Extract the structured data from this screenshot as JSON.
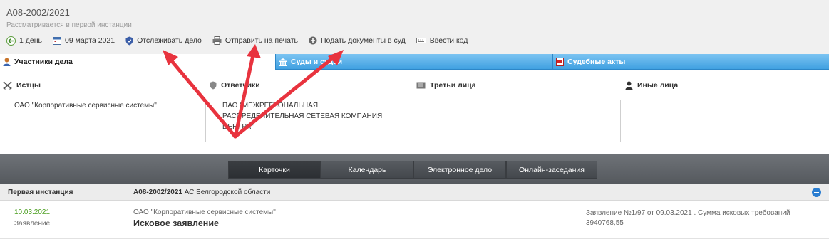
{
  "case": {
    "number": "А08-2002/2021",
    "status": "Рассматривается в первой инстанции"
  },
  "toolbar": {
    "days": "1 день",
    "date": "09 марта 2021",
    "track": "Отслеживать дело",
    "print": "Отправить на печать",
    "submit": "Подать документы в суд",
    "code": "Ввести код"
  },
  "tabs": {
    "participants": "Участники дела",
    "courts": "Суды и судьи",
    "acts": "Судебные акты"
  },
  "parties": {
    "plaintiffs": {
      "header": "Истцы",
      "items": [
        "ОАО \"Корпоративные сервисные системы\""
      ]
    },
    "defendants": {
      "header": "Ответчики",
      "lines": [
        "ПАО \"МЕЖРЕГИОНАЛЬНАЯ",
        "РАСПРЕДЕЛИТЕЛЬНАЯ СЕТЕВАЯ КОМПАНИЯ",
        "ЦЕНТРА\""
      ]
    },
    "third": {
      "header": "Третьи лица"
    },
    "other": {
      "header": "Иные лица"
    }
  },
  "nav": {
    "cards": "Карточки",
    "calendar": "Календарь",
    "ecase": "Электронное дело",
    "online": "Онлайн-заседания"
  },
  "instance": {
    "title": "Первая инстанция",
    "case_no": "А08-2002/2021",
    "court": "АС Белгородской области"
  },
  "document": {
    "date": "10.03.2021",
    "type": "Заявление",
    "party": "ОАО \"Корпоративные сервисные системы\"",
    "title": "Исковое заявление",
    "info_line1": "Заявление №1/97 от 09.03.2021 . Сумма исковых требований",
    "info_line2": "3940768,55"
  },
  "colors": {
    "tab_blue": "#3d9fe0",
    "date_green": "#4a9e1e",
    "arrow_red": "#e8333e",
    "collapse_blue": "#2a7dd1"
  }
}
